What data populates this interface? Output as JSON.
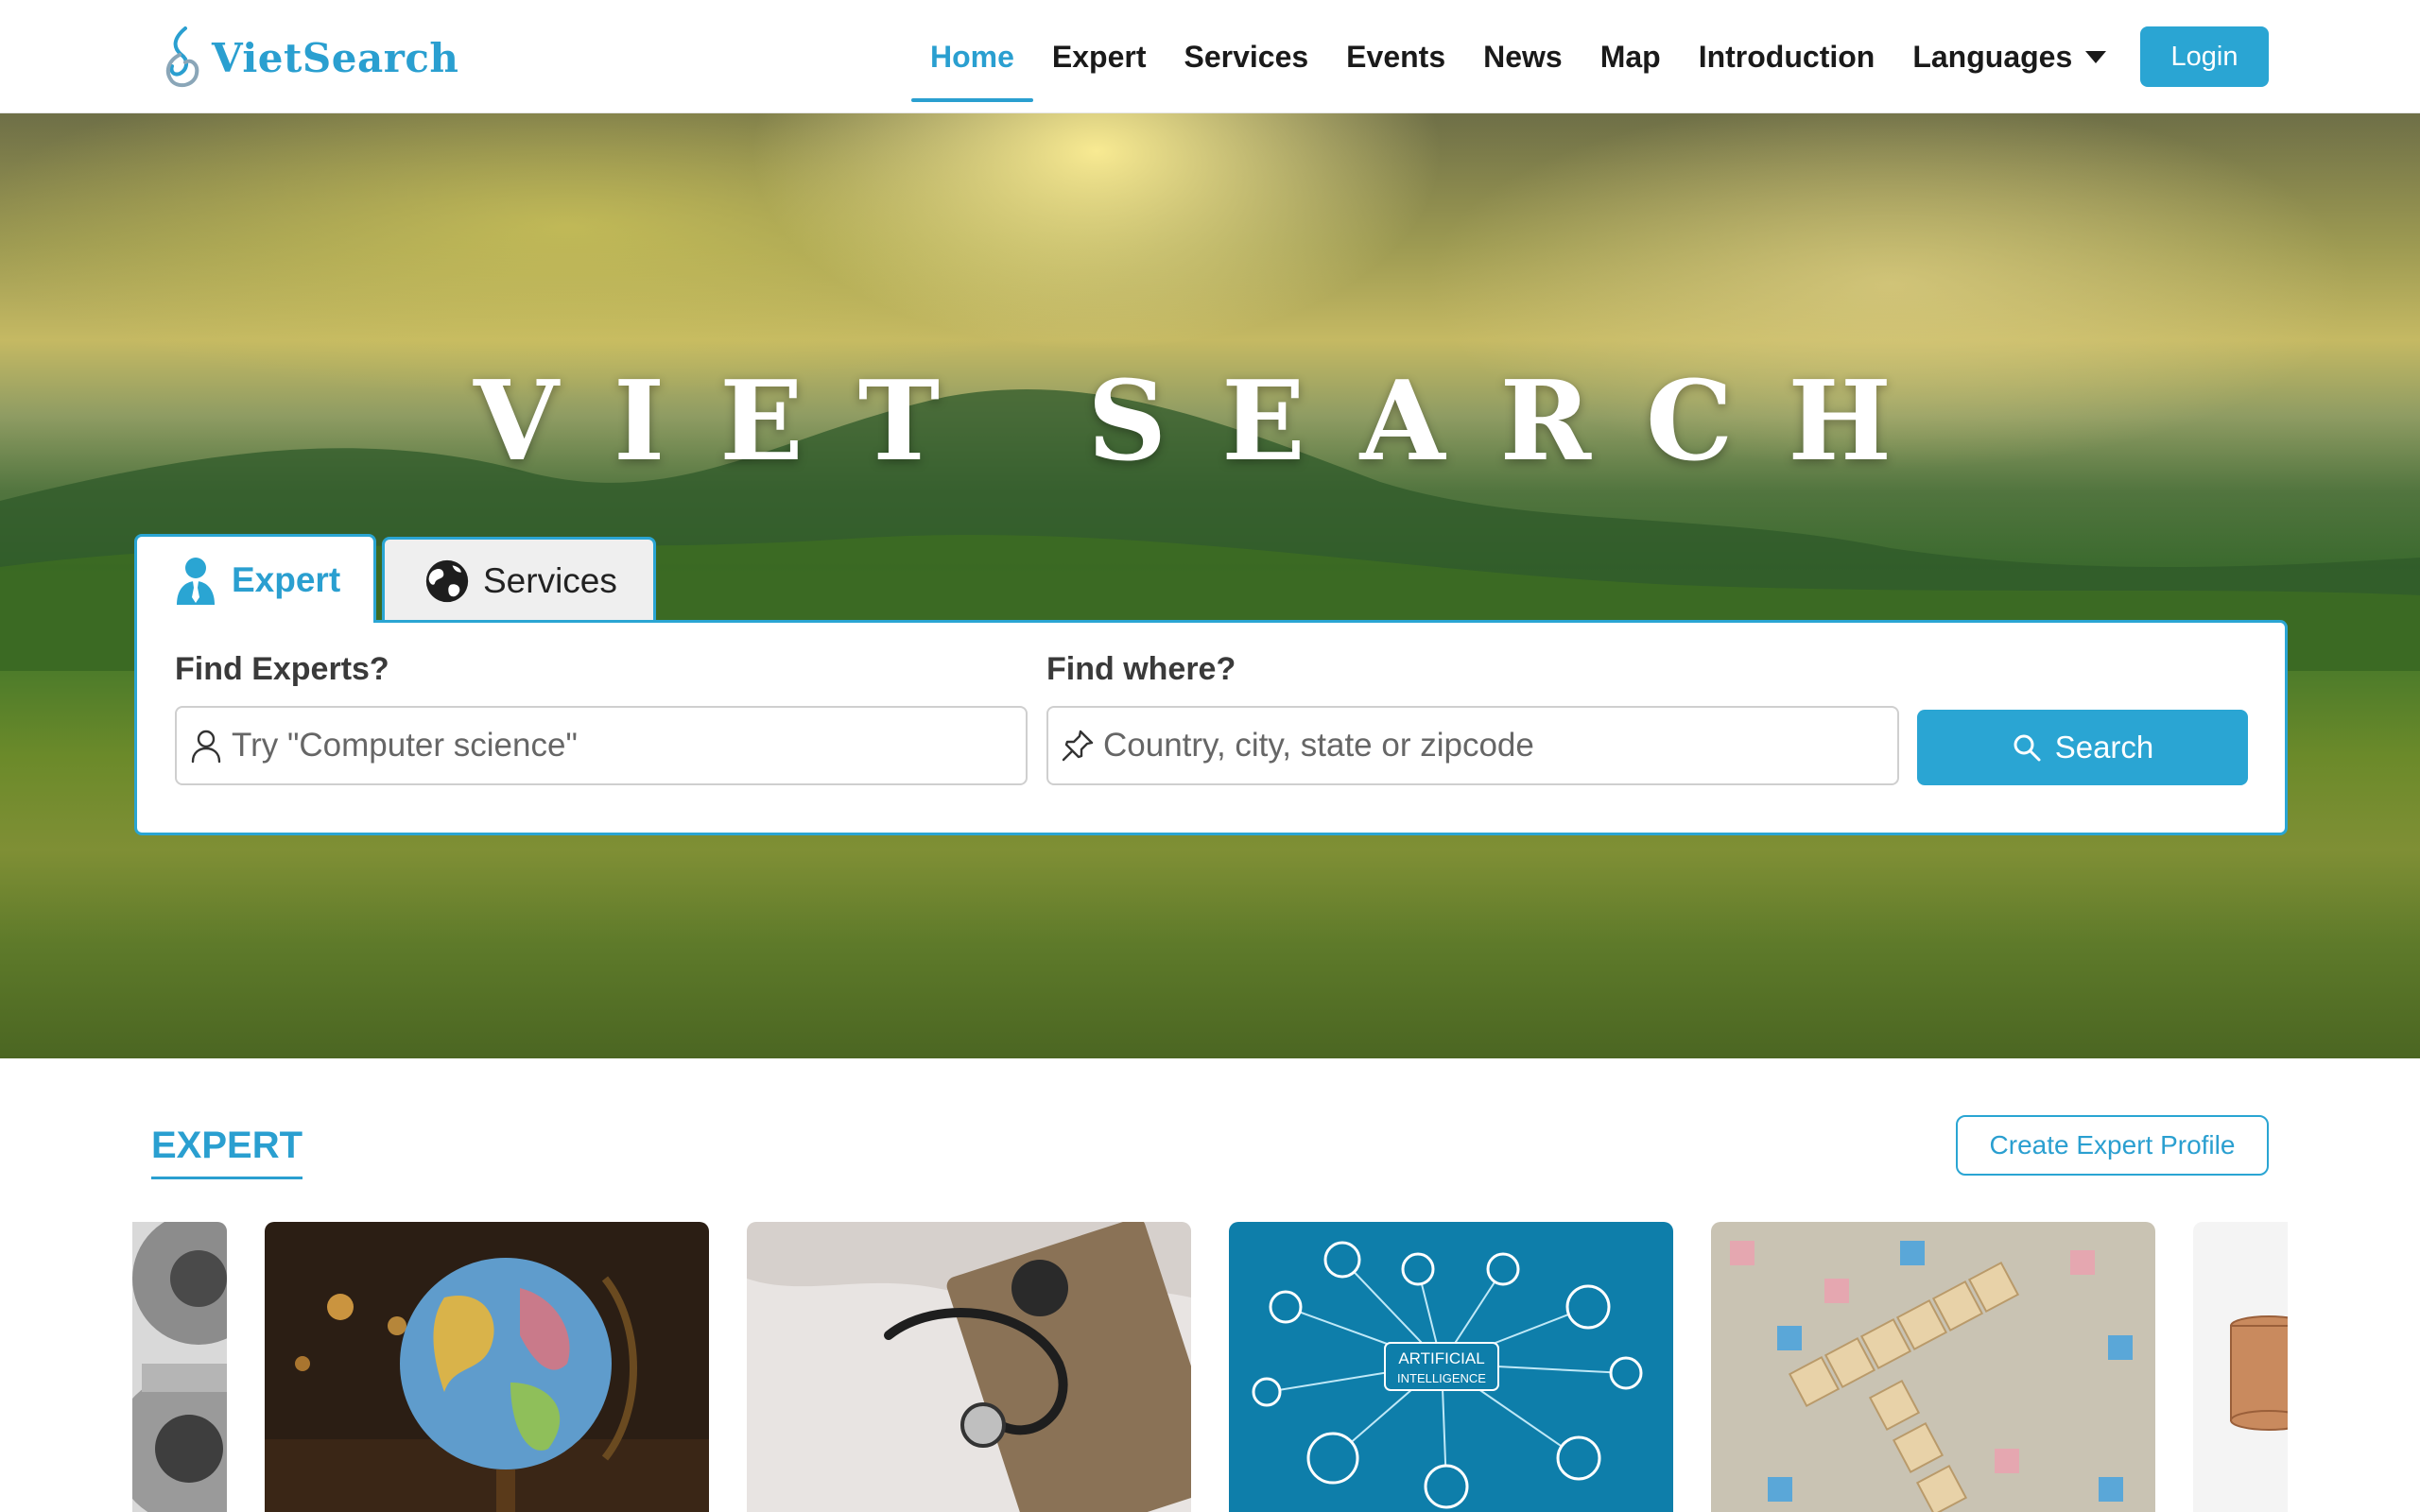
{
  "brand": {
    "name": "VietSearch"
  },
  "nav": {
    "items": [
      {
        "label": "Home",
        "active": true
      },
      {
        "label": "Expert"
      },
      {
        "label": "Services"
      },
      {
        "label": "Events"
      },
      {
        "label": "News"
      },
      {
        "label": "Map"
      },
      {
        "label": "Introduction"
      },
      {
        "label": "Languages",
        "dropdown": true
      }
    ],
    "login_label": "Login"
  },
  "hero": {
    "title": "VIET SEARCH"
  },
  "search": {
    "tabs": [
      {
        "label": "Expert",
        "active": true,
        "icon": "person-icon"
      },
      {
        "label": "Services",
        "icon": "globe-icon"
      }
    ],
    "what_label": "Find Experts?",
    "what_placeholder": "Try \"Computer science\"",
    "where_label": "Find where?",
    "where_placeholder": "Country, city, state or zipcode",
    "button_label": "Search"
  },
  "expert_section": {
    "title": "EXPERT",
    "create_label": "Create Expert Profile",
    "cards": [
      {
        "image": "gears"
      },
      {
        "image": "globe"
      },
      {
        "image": "stethoscope"
      },
      {
        "image": "artificial-intelligence",
        "image_text": [
          "ARTIFICIAL",
          "INTELLIGENCE"
        ]
      },
      {
        "image": "scrabble-bankruptcy"
      },
      {
        "image": "coins"
      }
    ]
  },
  "colors": {
    "accent": "#2aa5d3",
    "text": "#1a1a1a"
  }
}
